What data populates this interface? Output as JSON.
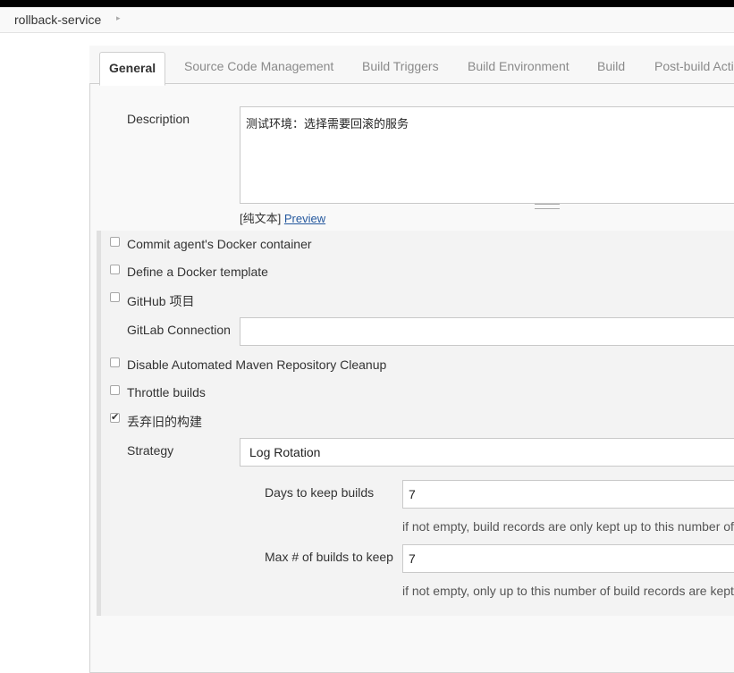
{
  "breadcrumb": {
    "item": "rollback-service",
    "separator": "▸"
  },
  "tabs": [
    {
      "label": "General"
    },
    {
      "label": "Source Code Management"
    },
    {
      "label": "Build Triggers"
    },
    {
      "label": "Build Environment"
    },
    {
      "label": "Build"
    },
    {
      "label": "Post-build Acti"
    }
  ],
  "description": {
    "label": "Description",
    "value": "测试环境：选择需要回滚的服务",
    "markup_prefix": "[纯文本]",
    "preview_link": "Preview"
  },
  "options": [
    {
      "label": "Commit agent's Docker container",
      "checked": false
    },
    {
      "label": "Define a Docker template",
      "checked": false
    },
    {
      "label": "GitHub 项目",
      "checked": false
    },
    {
      "label": "Disable Automated Maven Repository Cleanup",
      "checked": false
    },
    {
      "label": "Throttle builds",
      "checked": false
    },
    {
      "label": "丢弃旧的构建",
      "checked": true
    }
  ],
  "gitlab": {
    "label": "GitLab Connection",
    "value": ""
  },
  "strategy": {
    "label": "Strategy",
    "value": "Log Rotation"
  },
  "days_to_keep": {
    "label": "Days to keep builds",
    "value": "7",
    "hint": "if not empty, build records are only kept up to this number of"
  },
  "max_builds": {
    "label": "Max # of builds to keep",
    "value": "7",
    "hint": "if not empty, only up to this number of build records are kept"
  }
}
